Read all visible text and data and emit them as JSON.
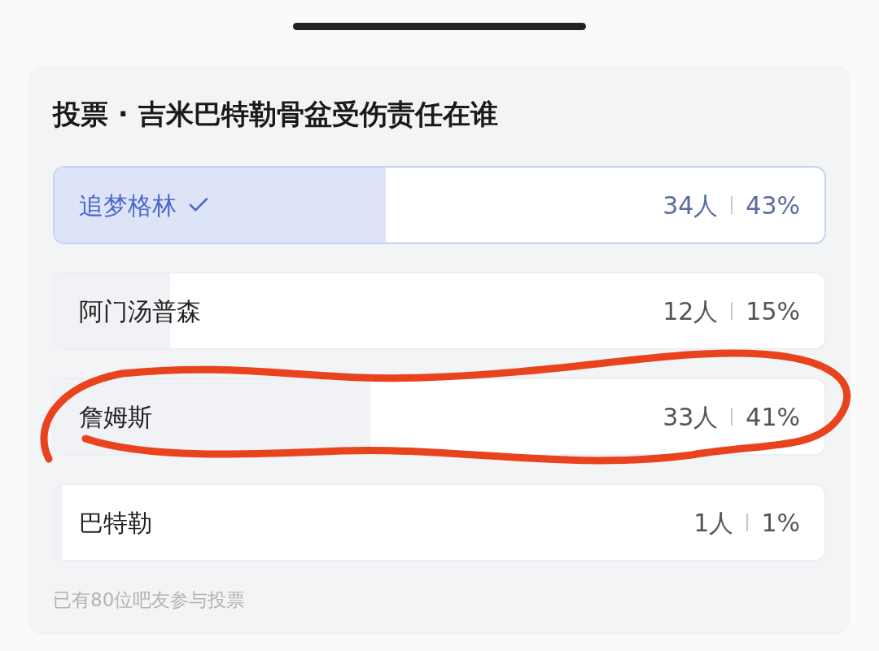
{
  "poll": {
    "title": "投票 · 吉米巴特勒骨盆受伤责任在谁",
    "options": [
      {
        "label": "追梦格林",
        "count": "34人",
        "percent": "43%",
        "level": 0.43,
        "selected": true,
        "highlighted": false
      },
      {
        "label": "阿门汤普森",
        "count": "12人",
        "percent": "15%",
        "level": 0.15,
        "selected": false,
        "highlighted": false
      },
      {
        "label": "詹姆斯",
        "count": "33人",
        "percent": "41%",
        "level": 0.41,
        "selected": false,
        "highlighted": true
      },
      {
        "label": "巴特勒",
        "count": "1人",
        "percent": "1%",
        "level": 0.01,
        "selected": false,
        "highlighted": false
      }
    ],
    "footer": "已有80位吧友参与投票"
  }
}
